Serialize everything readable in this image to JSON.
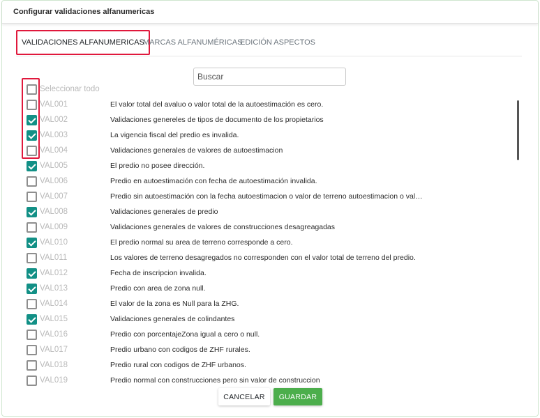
{
  "dialog": {
    "title": "Configurar validaciones alfanumericas"
  },
  "tabs": [
    {
      "label": "VALIDACIONES ALFANUMERICAS",
      "active": true
    },
    {
      "label": "MARCAS ALFANUMÉRICAS",
      "active": false
    },
    {
      "label": "EDICIÓN ASPECTOS",
      "active": false
    }
  ],
  "search": {
    "placeholder": "Buscar",
    "value": ""
  },
  "select_all": {
    "label": "Seleccionar todo",
    "checked": false
  },
  "validations": [
    {
      "code": "VAL001",
      "description": "El valor total del avaluo o valor total de la autoestimación es cero.",
      "checked": false
    },
    {
      "code": "VAL002",
      "description": "Validaciones genereles de tipos de documento de los propietarios",
      "checked": true
    },
    {
      "code": "VAL003",
      "description": "La vigencia fiscal del predio es invalida.",
      "checked": true
    },
    {
      "code": "VAL004",
      "description": "Validaciones generales de valores de autoestimacion",
      "checked": false
    },
    {
      "code": "VAL005",
      "description": "El predio no posee dirección.",
      "checked": true
    },
    {
      "code": "VAL006",
      "description": "Predio en autoestimación con fecha de autoestimación invalida.",
      "checked": false
    },
    {
      "code": "VAL007",
      "description": "Predio sin autoestimación con la fecha autoestimacion o valor de terreno autoestimacion o valor cons…",
      "checked": false
    },
    {
      "code": "VAL008",
      "description": "Validaciones generales de predio",
      "checked": true
    },
    {
      "code": "VAL009",
      "description": "Validaciones generales de valores de construcciones desagreagadas",
      "checked": false
    },
    {
      "code": "VAL010",
      "description": "El predio normal su area de terreno corresponde a cero.",
      "checked": true
    },
    {
      "code": "VAL011",
      "description": "Los valores de terreno desagregados no corresponden con el valor total de terreno del predio.",
      "checked": false
    },
    {
      "code": "VAL012",
      "description": "Fecha de inscripcion invalida.",
      "checked": true
    },
    {
      "code": "VAL013",
      "description": "Predio con area de zona null.",
      "checked": true
    },
    {
      "code": "VAL014",
      "description": "El valor de la zona es Null para la ZHG.",
      "checked": false
    },
    {
      "code": "VAL015",
      "description": "Validaciones generales de colindantes",
      "checked": true
    },
    {
      "code": "VAL016",
      "description": "Predio con porcentajeZona igual a cero o null.",
      "checked": false
    },
    {
      "code": "VAL017",
      "description": "Predio urbano con codigos de ZHF rurales.",
      "checked": false
    },
    {
      "code": "VAL018",
      "description": "Predio rural con codigos de ZHF urbanos.",
      "checked": false
    },
    {
      "code": "VAL019",
      "description": "Predio normal con construcciones pero sin valor de construccion",
      "checked": false
    }
  ],
  "buttons": {
    "cancel": "CANCELAR",
    "save": "GUARDAR"
  },
  "colors": {
    "checkbox_checked": "#129086",
    "save_button": "#4cae4c",
    "highlight": "#e0183c"
  }
}
